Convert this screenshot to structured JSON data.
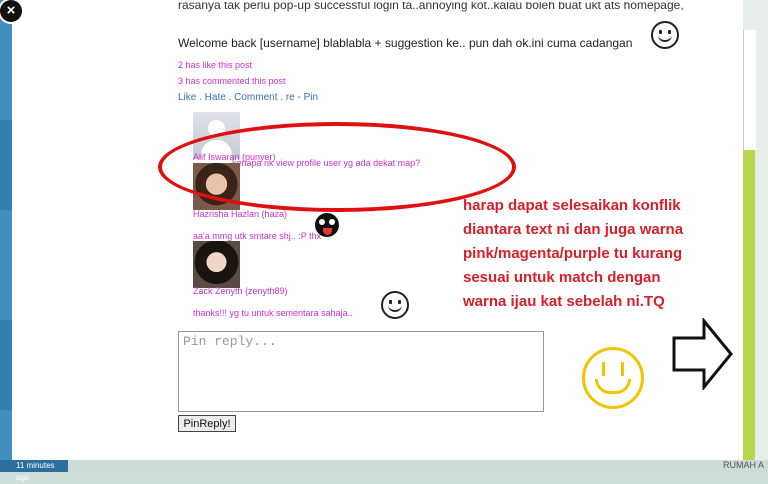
{
  "post": {
    "cut_line": "rasanya tak perlu pop-up successful login ta..annoying kot..kalau boleh buat ukt ats homepage,",
    "body": "Welcome back [username] blablabla + suggestion ke.. pun dah ok.ini cuma cadangan",
    "likes": "2 has like this post",
    "comments_count": "3 has commented this post",
    "actions": "Like . Hate . Comment . re - Pin"
  },
  "comments": [
    {
      "name": "Alif Iswaran (punyer)",
      "text": "kenapa nk view profile user yg ada dekat map?"
    },
    {
      "name": "Hazrisha Hazlan (haza)",
      "text": "aa'a mmg utk smtare shj.. :P thx"
    },
    {
      "name": "Zack Zenyth (zenyth89)",
      "text": "thanks!!! yg tu untuk sementara sahaja.."
    }
  ],
  "reply": {
    "placeholder": "Pin reply...",
    "button": "PinReply!"
  },
  "annotation": {
    "lines": [
      "harap dapat selesaikan konflik",
      "diantara text ni dan juga warna",
      "pink/magenta/purple tu kurang",
      "sesuai untuk match dengan",
      "warna ijau kat sebelah ni.TQ"
    ]
  },
  "background": {
    "timestamp": "11 minutes ago",
    "map_label": "RUMAH A"
  },
  "colors": {
    "comment_text": "#cc33cc",
    "link": "#3a6fb0",
    "annotation": "#d8202a",
    "side_bar": "#b5d84f"
  }
}
